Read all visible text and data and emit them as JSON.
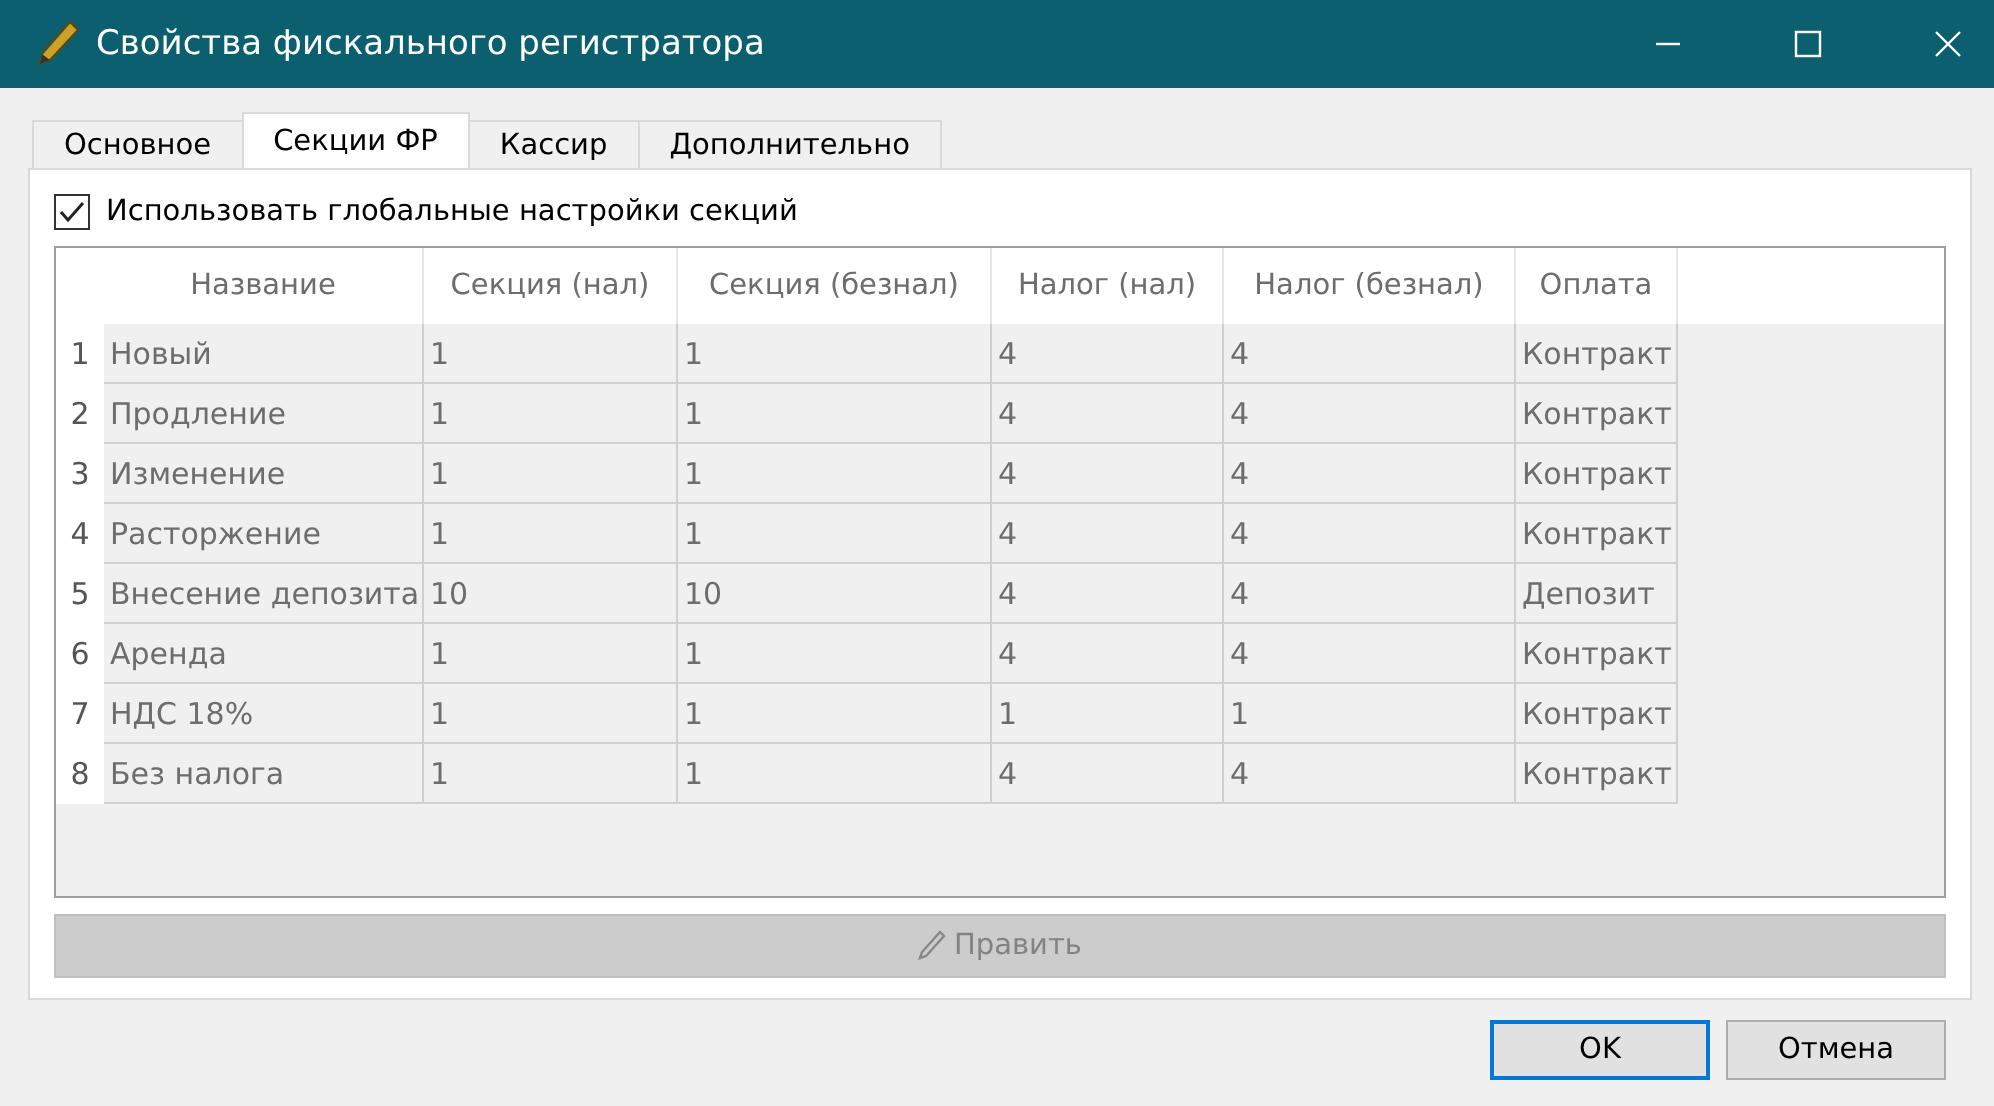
{
  "window": {
    "title": "Свойства фискального регистратора"
  },
  "tabs": [
    {
      "label": "Основное",
      "selected": false
    },
    {
      "label": "Секции ФР",
      "selected": true
    },
    {
      "label": "Кассир",
      "selected": false
    },
    {
      "label": "Дополнительно",
      "selected": false
    }
  ],
  "global_settings": {
    "label": "Использовать глобальные настройки секций",
    "checked": true
  },
  "table": {
    "disabled": true,
    "columns": [
      "Название",
      "Секция (нал)",
      "Секция (безнал)",
      "Налог (нал)",
      "Налог (безнал)",
      "Оплата"
    ],
    "rows": [
      {
        "number": "1",
        "cells": [
          "Новый",
          "1",
          "1",
          "4",
          "4",
          "Контракт"
        ]
      },
      {
        "number": "2",
        "cells": [
          "Продление",
          "1",
          "1",
          "4",
          "4",
          "Контракт"
        ]
      },
      {
        "number": "3",
        "cells": [
          "Изменение",
          "1",
          "1",
          "4",
          "4",
          "Контракт"
        ]
      },
      {
        "number": "4",
        "cells": [
          "Расторжение",
          "1",
          "1",
          "4",
          "4",
          "Контракт"
        ]
      },
      {
        "number": "5",
        "cells": [
          "Внесение депозита",
          "10",
          "10",
          "4",
          "4",
          "Депозит"
        ]
      },
      {
        "number": "6",
        "cells": [
          "Аренда",
          "1",
          "1",
          "4",
          "4",
          "Контракт"
        ]
      },
      {
        "number": "7",
        "cells": [
          "НДС 18%",
          "1",
          "1",
          "1",
          "1",
          "Контракт"
        ]
      },
      {
        "number": "8",
        "cells": [
          "Без налога",
          "1",
          "1",
          "4",
          "4",
          "Контракт"
        ]
      }
    ]
  },
  "edit_button": {
    "label": "Править",
    "disabled": true
  },
  "buttons": [
    {
      "label": "OK",
      "kind": "default"
    },
    {
      "label": "Отмена",
      "kind": "normal"
    }
  ]
}
